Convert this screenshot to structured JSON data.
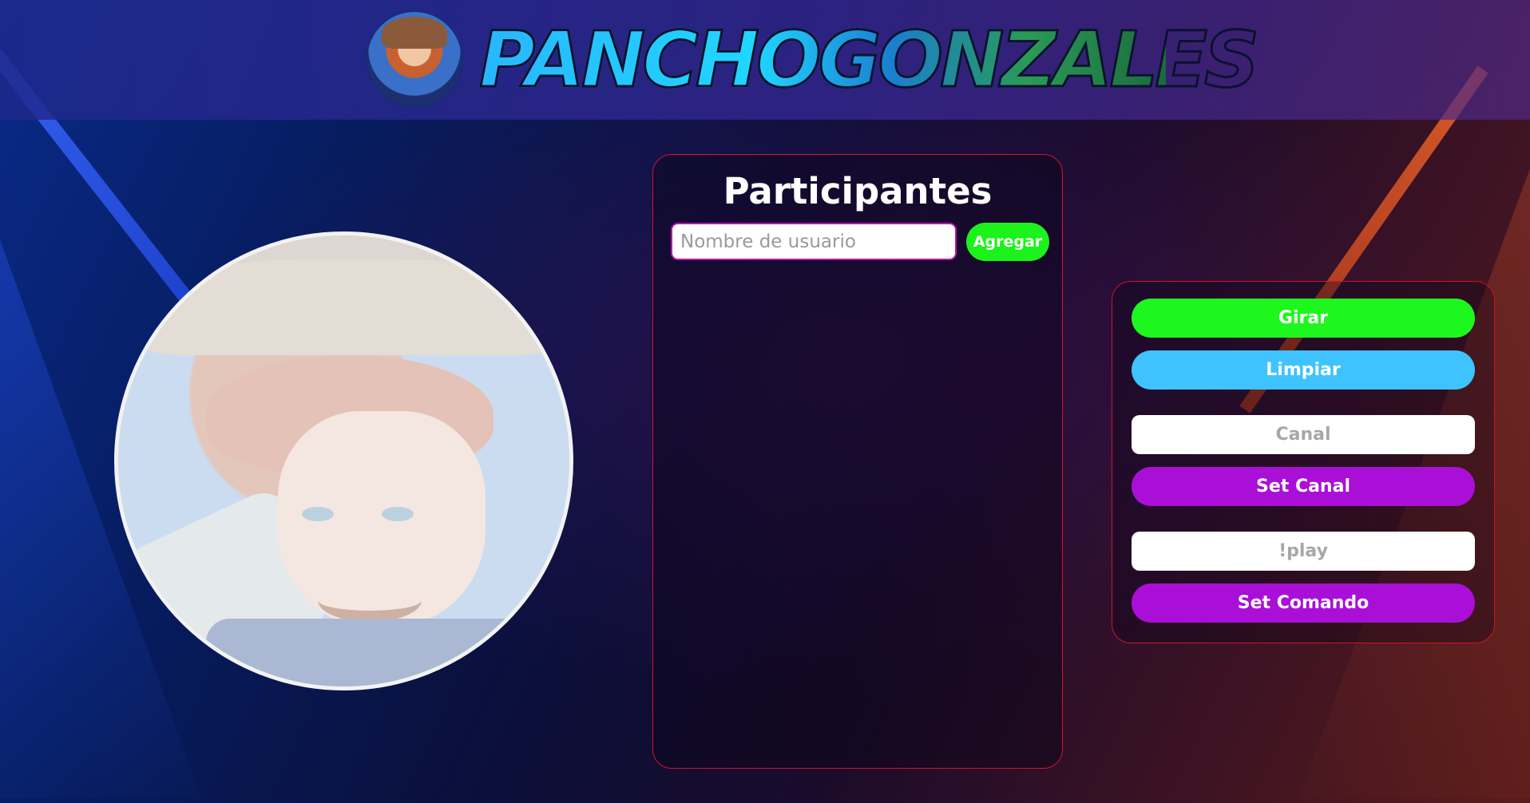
{
  "header": {
    "logo_text": "PANCHOGONZALES",
    "avatar_icon": "streamer-avatar-icon"
  },
  "participants": {
    "title": "Participantes",
    "username_placeholder": "Nombre de usuario",
    "add_label": "Agregar",
    "items": []
  },
  "controls": {
    "spin_label": "Girar",
    "clear_label": "Limpiar",
    "channel_placeholder": "Canal",
    "set_channel_label": "Set Canal",
    "command_placeholder": "!play",
    "set_command_label": "Set Comando"
  },
  "colors": {
    "accent_green": "#1ef71e",
    "accent_blue": "#3ec3ff",
    "accent_purple": "#aa0fd8",
    "panel_border": "#d4122a"
  }
}
